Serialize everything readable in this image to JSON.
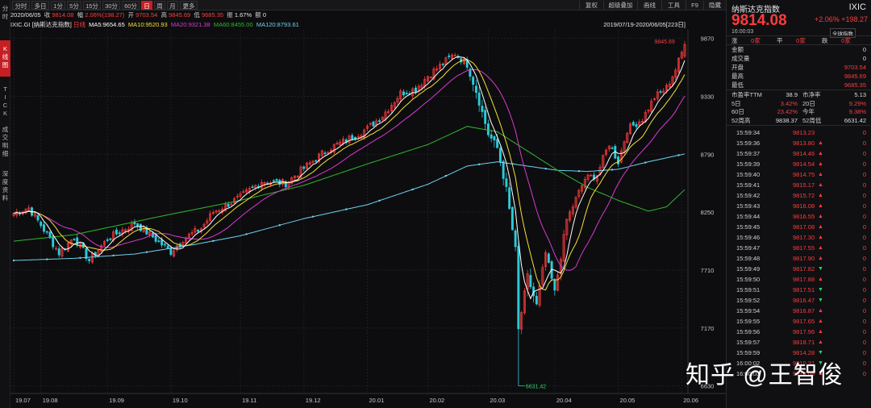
{
  "left_rail": [
    {
      "label": "分时",
      "active": false
    },
    {
      "label": "K线图",
      "active": true
    },
    {
      "label": "TICK",
      "active": false
    },
    {
      "label": "成交明细",
      "active": false
    },
    {
      "label": "深度资料",
      "active": false
    }
  ],
  "toolbar": {
    "periods": [
      "分时",
      "多日",
      "1分",
      "5分",
      "15分",
      "30分",
      "60分",
      "日",
      "周",
      "月",
      "更多"
    ],
    "active_period": "日",
    "right_buttons": [
      "复权",
      "超级叠加",
      "画线",
      "工具",
      "F9",
      "隐藏"
    ]
  },
  "info_bar": {
    "date": "2020/06/05",
    "close_label": "收",
    "close": "9814.08",
    "change_label": "幅",
    "change": "2.06%(198.27)",
    "open_label": "开",
    "open": "9703.54",
    "high_label": "高",
    "high": "9845.69",
    "low_label": "低",
    "low": "9685.35",
    "amp_label": "振",
    "amp": "1.67%",
    "vol_label": "额",
    "vol": "0"
  },
  "ma_bar": {
    "symbol": "IXIC.GI",
    "name": "[纳斯达克指数]",
    "adj": "日线",
    "ma5": "MA5:9654.65",
    "ma10": "MA10:9520.93",
    "ma20": "MA20:9321.38",
    "ma60": "MA60:8455.00",
    "ma120": "MA120:8793.61",
    "range": "2019/07/19-2020/06/05[223日]"
  },
  "colors": {
    "up": "#ff3b3b",
    "down": "#2ecad8",
    "ma5": "#ffffff",
    "ma10": "#f2e13a",
    "ma20": "#d83ad0",
    "ma60": "#2eb82e",
    "ma120": "#6fd3f0"
  },
  "chart_data": {
    "type": "candlestick",
    "title": "",
    "y_ticks": [
      9870,
      9330,
      8790,
      8250,
      7710,
      7170,
      6630
    ],
    "ylim": [
      6560,
      9950
    ],
    "x_ticks": [
      "19.07",
      "19.08",
      "19.09",
      "19.10",
      "19.11",
      "19.12",
      "20.01",
      "20.02",
      "20.03",
      "20.04",
      "20.05",
      "20.06"
    ],
    "x_tick_index": [
      0,
      9,
      31,
      52,
      75,
      96,
      117,
      137,
      157,
      179,
      200,
      221
    ],
    "annotations": [
      {
        "text": "9845.69",
        "index": 220,
        "value": 9845.69
      },
      {
        "text": "6631.42",
        "index": 167,
        "value": 6631.42
      }
    ],
    "n_points": 223,
    "close_anchors": [
      [
        0,
        8240
      ],
      [
        5,
        8290
      ],
      [
        9,
        8130
      ],
      [
        15,
        7870
      ],
      [
        20,
        8020
      ],
      [
        25,
        7800
      ],
      [
        31,
        8000
      ],
      [
        40,
        8150
      ],
      [
        46,
        8020
      ],
      [
        52,
        7880
      ],
      [
        56,
        8000
      ],
      [
        62,
        8100
      ],
      [
        66,
        8250
      ],
      [
        75,
        8390
      ],
      [
        82,
        8540
      ],
      [
        90,
        8520
      ],
      [
        96,
        8660
      ],
      [
        104,
        8840
      ],
      [
        110,
        8920
      ],
      [
        117,
        9030
      ],
      [
        122,
        9150
      ],
      [
        128,
        9360
      ],
      [
        133,
        9400
      ],
      [
        137,
        9520
      ],
      [
        143,
        9660
      ],
      [
        146,
        9730
      ],
      [
        150,
        9630
      ],
      [
        153,
        9380
      ],
      [
        157,
        8980
      ],
      [
        160,
        8850
      ],
      [
        163,
        8460
      ],
      [
        166,
        7900
      ],
      [
        167,
        7150
      ],
      [
        170,
        7650
      ],
      [
        173,
        7380
      ],
      [
        176,
        7870
      ],
      [
        179,
        7500
      ],
      [
        183,
        8180
      ],
      [
        189,
        8560
      ],
      [
        193,
        8600
      ],
      [
        197,
        8890
      ],
      [
        200,
        8720
      ],
      [
        203,
        9020
      ],
      [
        208,
        9120
      ],
      [
        212,
        9320
      ],
      [
        216,
        9410
      ],
      [
        219,
        9580
      ],
      [
        222,
        9814.08
      ]
    ],
    "ma60_anchors": [
      [
        0,
        7980
      ],
      [
        20,
        8040
      ],
      [
        50,
        8220
      ],
      [
        75,
        8360
      ],
      [
        96,
        8500
      ],
      [
        117,
        8700
      ],
      [
        137,
        8880
      ],
      [
        150,
        9050
      ],
      [
        160,
        9000
      ],
      [
        170,
        8820
      ],
      [
        180,
        8640
      ],
      [
        190,
        8480
      ],
      [
        200,
        8360
      ],
      [
        210,
        8260
      ],
      [
        216,
        8300
      ],
      [
        222,
        8460
      ]
    ],
    "ma120_anchors": [
      [
        0,
        7800
      ],
      [
        20,
        7820
      ],
      [
        40,
        7860
      ],
      [
        60,
        7950
      ],
      [
        75,
        8030
      ],
      [
        96,
        8190
      ],
      [
        117,
        8320
      ],
      [
        137,
        8510
      ],
      [
        150,
        8680
      ],
      [
        160,
        8720
      ],
      [
        170,
        8680
      ],
      [
        180,
        8640
      ],
      [
        190,
        8630
      ],
      [
        200,
        8650
      ],
      [
        210,
        8720
      ],
      [
        222,
        8793.61
      ]
    ]
  },
  "right_panel": {
    "title": "纳斯达克指数",
    "code": "IXIC",
    "price": "9814.08",
    "change": "+2.06% +198.27",
    "time": "16:00:03",
    "global_label": "全球指数",
    "updown": [
      {
        "label": "涨",
        "value": "0家"
      },
      {
        "label": "平",
        "value": "0家"
      },
      {
        "label": "跌",
        "value": "0家"
      }
    ],
    "stats": [
      {
        "label": "金额",
        "value": "0"
      },
      {
        "label": "成交量",
        "value": "0"
      },
      {
        "label": "开盘",
        "value": "9703.54"
      },
      {
        "label": "最高",
        "value": "9845.69"
      },
      {
        "label": "最低",
        "value": "9685.35"
      }
    ],
    "stats2": [
      {
        "l1": "市盈率TTM",
        "v1": "38.9",
        "l2": "市净率",
        "v2": "5.13"
      },
      {
        "l1": "5日",
        "v1": "3.42%",
        "l2": "20日",
        "v2": "9.29%"
      },
      {
        "l1": "60日",
        "v1": "23.42%",
        "l2": "今年",
        "v2": "9.38%"
      },
      {
        "l1": "52周高",
        "v1": "9838.37",
        "l2": "52周低",
        "v2": "6631.42"
      }
    ],
    "ticks": [
      {
        "t": "15:59:34",
        "p": "9813.23",
        "dir": "",
        "v": "0"
      },
      {
        "t": "15:59:36",
        "p": "9813.80",
        "dir": "up",
        "v": "0"
      },
      {
        "t": "15:59:37",
        "p": "9814.46",
        "dir": "up",
        "v": "0"
      },
      {
        "t": "15:59:39",
        "p": "9814.54",
        "dir": "up",
        "v": "0"
      },
      {
        "t": "15:59:40",
        "p": "9814.75",
        "dir": "up",
        "v": "0"
      },
      {
        "t": "15:59:41",
        "p": "9815.17",
        "dir": "up",
        "v": "0"
      },
      {
        "t": "15:59:42",
        "p": "9815.72",
        "dir": "up",
        "v": "0"
      },
      {
        "t": "15:59:43",
        "p": "9816.08",
        "dir": "up",
        "v": "0"
      },
      {
        "t": "15:59:44",
        "p": "9816.55",
        "dir": "up",
        "v": "0"
      },
      {
        "t": "15:59:45",
        "p": "9817.08",
        "dir": "up",
        "v": "0"
      },
      {
        "t": "15:59:46",
        "p": "9817.30",
        "dir": "up",
        "v": "0"
      },
      {
        "t": "15:59:47",
        "p": "9817.55",
        "dir": "up",
        "v": "0"
      },
      {
        "t": "15:59:48",
        "p": "9817.90",
        "dir": "up",
        "v": "0"
      },
      {
        "t": "15:59:49",
        "p": "9817.82",
        "dir": "down",
        "v": "0"
      },
      {
        "t": "15:59:50",
        "p": "9817.88",
        "dir": "up",
        "v": "0"
      },
      {
        "t": "15:59:51",
        "p": "9817.51",
        "dir": "down",
        "v": "0"
      },
      {
        "t": "15:59:52",
        "p": "9816.47",
        "dir": "down",
        "v": "0"
      },
      {
        "t": "15:59:54",
        "p": "9816.87",
        "dir": "up",
        "v": "0"
      },
      {
        "t": "15:59:55",
        "p": "9817.65",
        "dir": "up",
        "v": "0"
      },
      {
        "t": "15:59:56",
        "p": "9817.96",
        "dir": "up",
        "v": "0"
      },
      {
        "t": "15:59:57",
        "p": "9818.71",
        "dir": "up",
        "v": "0"
      },
      {
        "t": "15:59:59",
        "p": "9814.28",
        "dir": "down",
        "v": "0"
      },
      {
        "t": "16:00:02",
        "p": "9810.31",
        "dir": "down",
        "v": "0"
      },
      {
        "t": "16:00:03",
        "p": "9814.08",
        "dir": "up",
        "v": "0"
      }
    ]
  },
  "watermark": "知乎 @王智俊"
}
